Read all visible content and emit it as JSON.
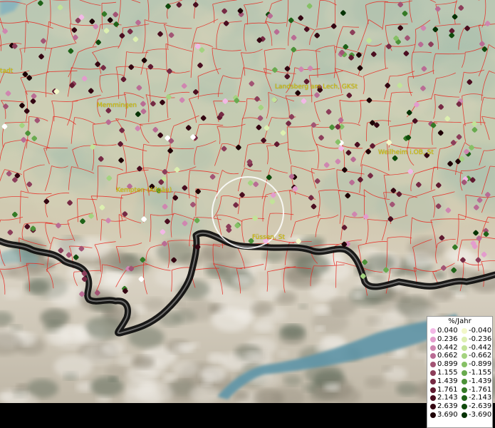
{
  "map": {
    "place_labels": {
      "memmingen": "Memmingen",
      "landsberg": "Landsberg am Lech, GKSt",
      "kempten": "Kempten (Allgäu)",
      "weilheim": "Weilheim i.OB, St",
      "fuessen": "Füssen, St",
      "left_edge": "tadt"
    },
    "colors": {
      "boundary": "#e8261f",
      "border_line": "#0a0a0a",
      "highlight_circle": "#ffffff",
      "label": "#d8c400"
    }
  },
  "legend": {
    "title": "%/Jahr",
    "positive": [
      {
        "label": "0.040",
        "color": "#f2b8e6"
      },
      {
        "label": "0.236",
        "color": "#e39ccd"
      },
      {
        "label": "0.442",
        "color": "#cf86b0"
      },
      {
        "label": "0.662",
        "color": "#b96c94"
      },
      {
        "label": "0.899",
        "color": "#a25474"
      },
      {
        "label": "1.155",
        "color": "#8c3e5a"
      },
      {
        "label": "1.439",
        "color": "#762a44"
      },
      {
        "label": "1.761",
        "color": "#601a30"
      },
      {
        "label": "2.143",
        "color": "#4a0e20"
      },
      {
        "label": "2.639",
        "color": "#340612"
      },
      {
        "label": "3.690",
        "color": "#1e0206"
      }
    ],
    "negative": [
      {
        "label": "-0.040",
        "color": "#f2f7c8"
      },
      {
        "label": "-0.236",
        "color": "#dcefb0"
      },
      {
        "label": "-0.442",
        "color": "#c2e398"
      },
      {
        "label": "-0.662",
        "color": "#a4d380"
      },
      {
        "label": "-0.899",
        "color": "#86c066"
      },
      {
        "label": "-1.155",
        "color": "#68aa4e"
      },
      {
        "label": "-1.439",
        "color": "#4c9238"
      },
      {
        "label": "-1.761",
        "color": "#347a26"
      },
      {
        "label": "-2.143",
        "color": "#1f6218"
      },
      {
        "label": "-2.639",
        "color": "#0f4a0c"
      },
      {
        "label": "-3.690",
        "color": "#053204"
      }
    ]
  }
}
